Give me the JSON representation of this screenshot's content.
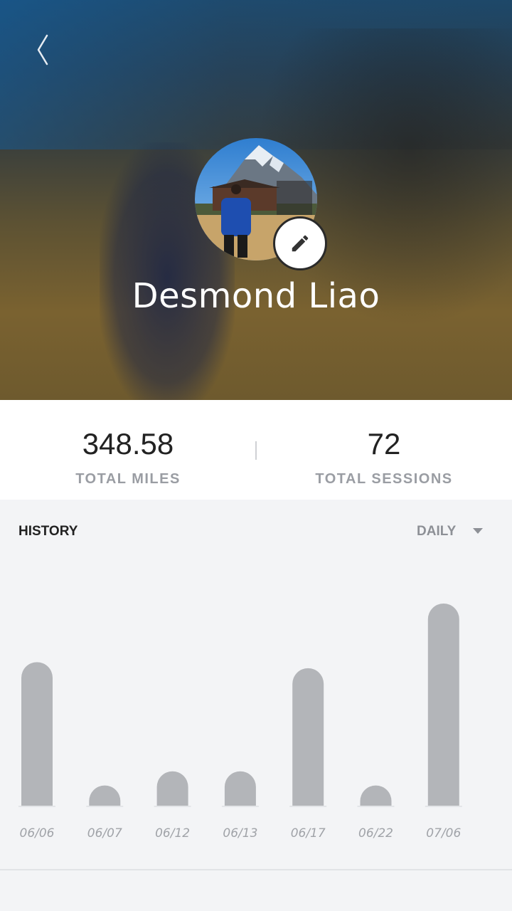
{
  "profile": {
    "name": "Desmond Liao"
  },
  "stats": {
    "total_miles": {
      "value": "348.58",
      "label": "TOTAL MILES"
    },
    "total_sessions": {
      "value": "72",
      "label": "TOTAL SESSIONS"
    }
  },
  "history": {
    "title": "HISTORY",
    "period": "DAILY"
  },
  "colors": {
    "bar": "#b3b5b9",
    "tick_label": "#a0a3a8",
    "background": "#f3f4f6"
  },
  "icons": {
    "back": "chevron-left-icon",
    "edit": "pencil-icon",
    "dropdown": "caret-down-icon"
  },
  "chart_data": {
    "type": "bar",
    "categories": [
      "06/06",
      "06/07",
      "06/12",
      "06/13",
      "06/17",
      "06/22",
      "07/06"
    ],
    "values": [
      0.71,
      0.1,
      0.17,
      0.17,
      0.68,
      0.1,
      1.0
    ],
    "title": "",
    "xlabel": "",
    "ylabel": "",
    "ylim": [
      0,
      1.0
    ],
    "grid": false
  }
}
